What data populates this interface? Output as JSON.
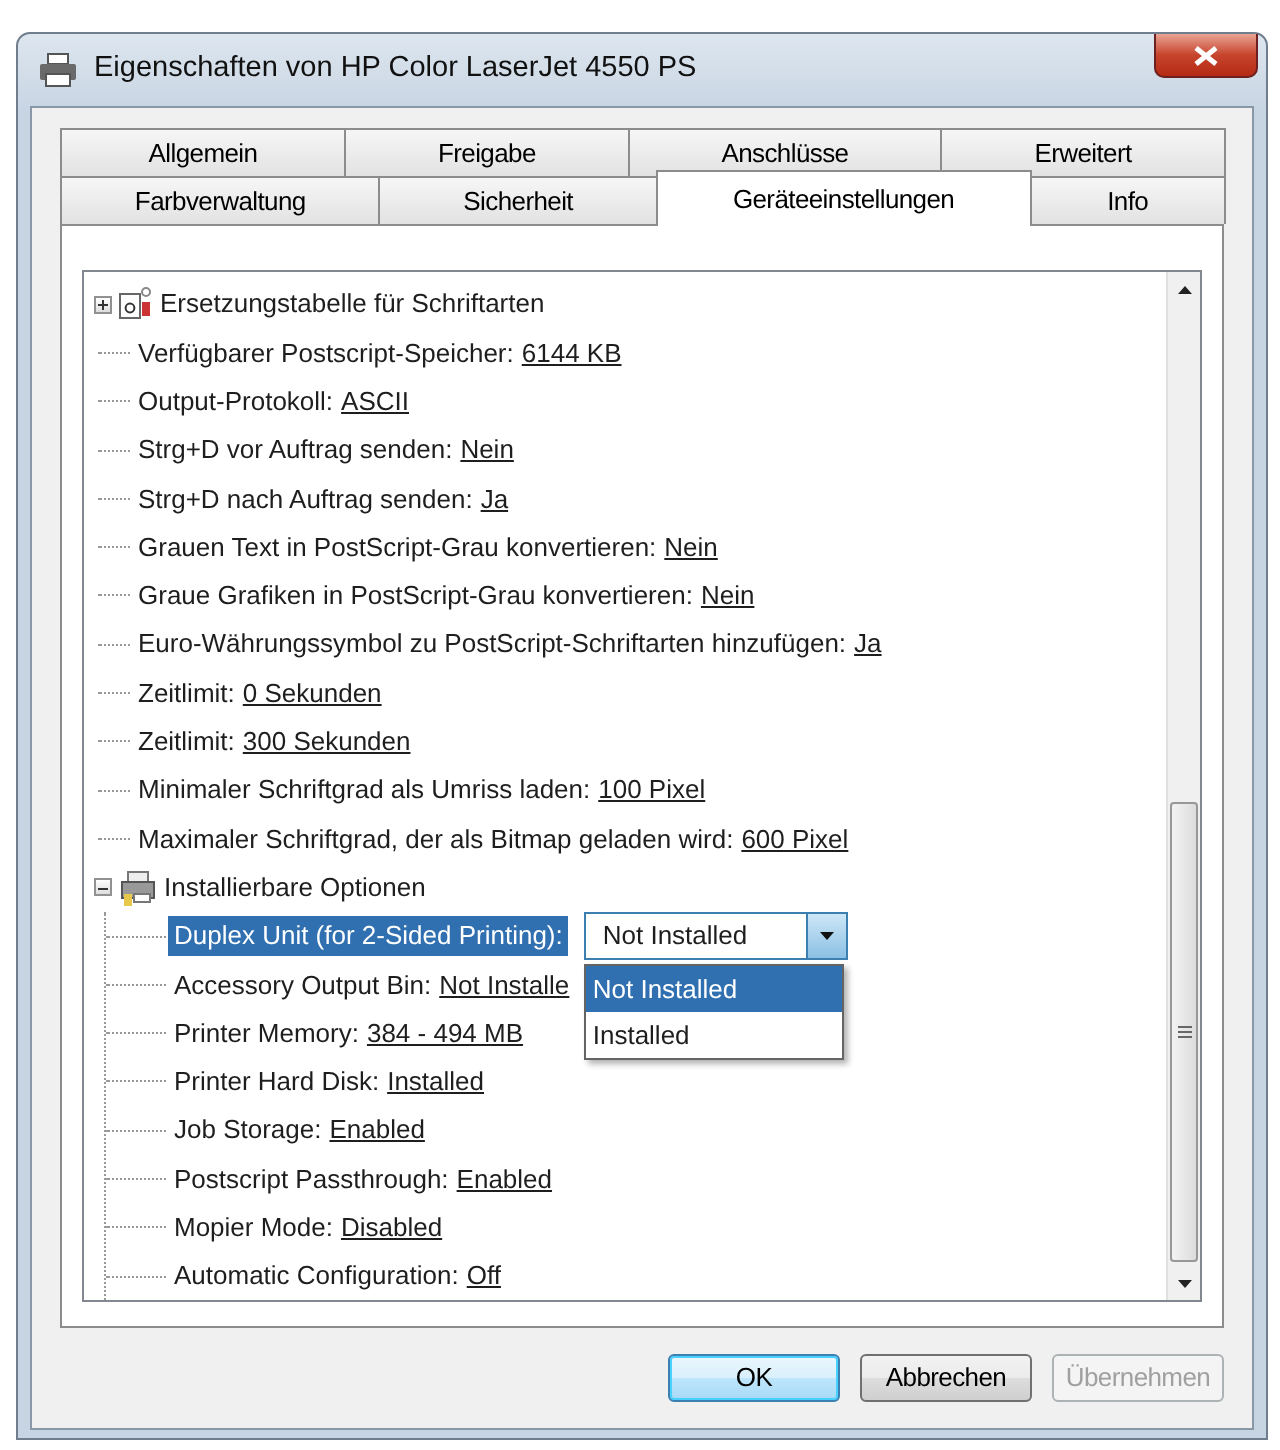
{
  "window": {
    "title": "Eigenschaften von HP Color LaserJet 4550 PS"
  },
  "tabs": [
    [
      {
        "label": "Allgemein",
        "selected": false
      },
      {
        "label": "Freigabe",
        "selected": false
      },
      {
        "label": "Anschlüsse",
        "selected": false
      },
      {
        "label": "Erweitert",
        "selected": false
      }
    ],
    [
      {
        "label": "Farbverwaltung",
        "selected": false
      },
      {
        "label": "Sicherheit",
        "selected": false
      },
      {
        "label": "Geräteeinstellungen",
        "selected": true
      },
      {
        "label": "Info",
        "selected": false
      }
    ]
  ],
  "tree": [
    {
      "kind": "group",
      "label": "Ersetzungstabelle für Schriftarten",
      "expanded": false
    },
    {
      "kind": "setting",
      "label": "Verfügbarer Postscript-Speicher:",
      "value": "6144 KB"
    },
    {
      "kind": "setting",
      "label": "Output-Protokoll:",
      "value": "ASCII"
    },
    {
      "kind": "setting",
      "label": "Strg+D vor Auftrag senden:",
      "value": "Nein"
    },
    {
      "kind": "setting",
      "label": "Strg+D nach Auftrag senden:",
      "value": "Ja"
    },
    {
      "kind": "setting",
      "label": "Grauen Text in PostScript-Grau konvertieren:",
      "value": "Nein"
    },
    {
      "kind": "setting",
      "label": "Graue Grafiken in PostScript-Grau konvertieren:",
      "value": "Nein"
    },
    {
      "kind": "setting",
      "label": "Euro-Währungssymbol zu PostScript-Schriftarten hinzufügen:",
      "value": "Ja"
    },
    {
      "kind": "setting",
      "label": "Zeitlimit:",
      "value": "0 Sekunden"
    },
    {
      "kind": "setting",
      "label": "Zeitlimit:",
      "value": "300 Sekunden"
    },
    {
      "kind": "setting",
      "label": "Minimaler Schriftgrad als Umriss laden:",
      "value": "100 Pixel"
    },
    {
      "kind": "setting",
      "label": "Maximaler Schriftgrad, der als Bitmap geladen wird:",
      "value": "600 Pixel"
    },
    {
      "kind": "group",
      "label": "Installierbare Optionen",
      "expanded": true,
      "children": [
        {
          "kind": "combo",
          "label": "Duplex Unit (for 2-Sided Printing):",
          "value": "Not Installed",
          "selected": true,
          "open": true,
          "options": [
            {
              "label": "Not Installed",
              "selected": true
            },
            {
              "label": "Installed",
              "selected": false
            }
          ]
        },
        {
          "kind": "setting",
          "label": "Accessory Output Bin:",
          "value": "Not Installe",
          "selected": false
        },
        {
          "kind": "setting",
          "label": "Printer Memory:",
          "value": "384 - 494 MB",
          "selected": false
        },
        {
          "kind": "setting",
          "label": "Printer Hard Disk:",
          "value": "Installed",
          "selected": false
        },
        {
          "kind": "setting",
          "label": "Job Storage:",
          "value": "Enabled",
          "selected": false
        },
        {
          "kind": "setting",
          "label": "Postscript Passthrough:",
          "value": "Enabled",
          "selected": false
        },
        {
          "kind": "setting",
          "label": "Mopier Mode:",
          "value": "Disabled",
          "selected": false
        },
        {
          "kind": "setting",
          "label": "Automatic Configuration:",
          "value": "Off",
          "selected": false
        }
      ]
    }
  ],
  "buttons": [
    {
      "label": "OK",
      "default": true,
      "disabled": false
    },
    {
      "label": "Abbrechen",
      "default": false,
      "disabled": false
    },
    {
      "label": "Übernehmen",
      "default": false,
      "disabled": true
    }
  ]
}
